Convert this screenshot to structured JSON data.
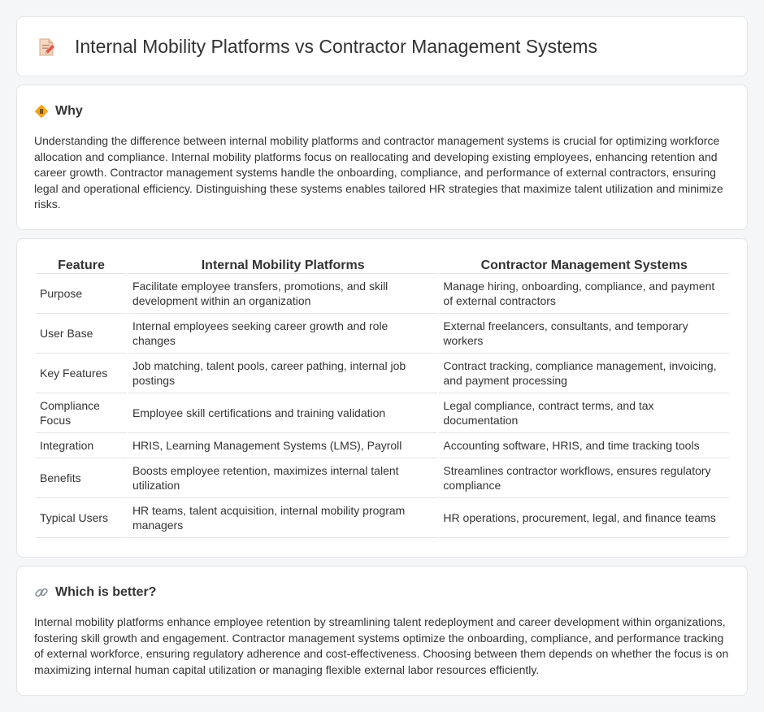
{
  "page": {
    "title": "Internal Mobility Platforms vs Contractor Management Systems",
    "header_icon": "document-pencil-icon"
  },
  "why": {
    "icon": "diamond-warning-icon",
    "heading": "Why",
    "text": "Understanding the difference between internal mobility platforms and contractor management systems is crucial for optimizing workforce allocation and compliance. Internal mobility platforms focus on reallocating and developing existing employees, enhancing retention and career growth. Contractor management systems handle the onboarding, compliance, and performance of external contractors, ensuring legal and operational efficiency. Distinguishing these systems enables tailored HR strategies that maximize talent utilization and minimize risks."
  },
  "table": {
    "headers": [
      "Feature",
      "Internal Mobility Platforms",
      "Contractor Management Systems"
    ],
    "rows": [
      [
        "Purpose",
        "Facilitate employee transfers, promotions, and skill development within an organization",
        "Manage hiring, onboarding, compliance, and payment of external contractors"
      ],
      [
        "User Base",
        "Internal employees seeking career growth and role changes",
        "External freelancers, consultants, and temporary workers"
      ],
      [
        "Key Features",
        "Job matching, talent pools, career pathing, internal job postings",
        "Contract tracking, compliance management, invoicing, and payment processing"
      ],
      [
        "Compliance Focus",
        "Employee skill certifications and training validation",
        "Legal compliance, contract terms, and tax documentation"
      ],
      [
        "Integration",
        "HRIS, Learning Management Systems (LMS), Payroll",
        "Accounting software, HRIS, and time tracking tools"
      ],
      [
        "Benefits",
        "Boosts employee retention, maximizes internal talent utilization",
        "Streamlines contractor workflows, ensures regulatory compliance"
      ],
      [
        "Typical Users",
        "HR teams, talent acquisition, internal mobility program managers",
        "HR operations, procurement, legal, and finance teams"
      ]
    ]
  },
  "better": {
    "icon": "link-icon",
    "heading": "Which is better?",
    "text": "Internal mobility platforms enhance employee retention by streamlining talent redeployment and career development within organizations, fostering skill growth and engagement. Contractor management systems optimize the onboarding, compliance, and performance tracking of external workforce, ensuring regulatory adherence and cost-effectiveness. Choosing between them depends on whether the focus is on maximizing internal human capital utilization or managing flexible external labor resources efficiently."
  }
}
